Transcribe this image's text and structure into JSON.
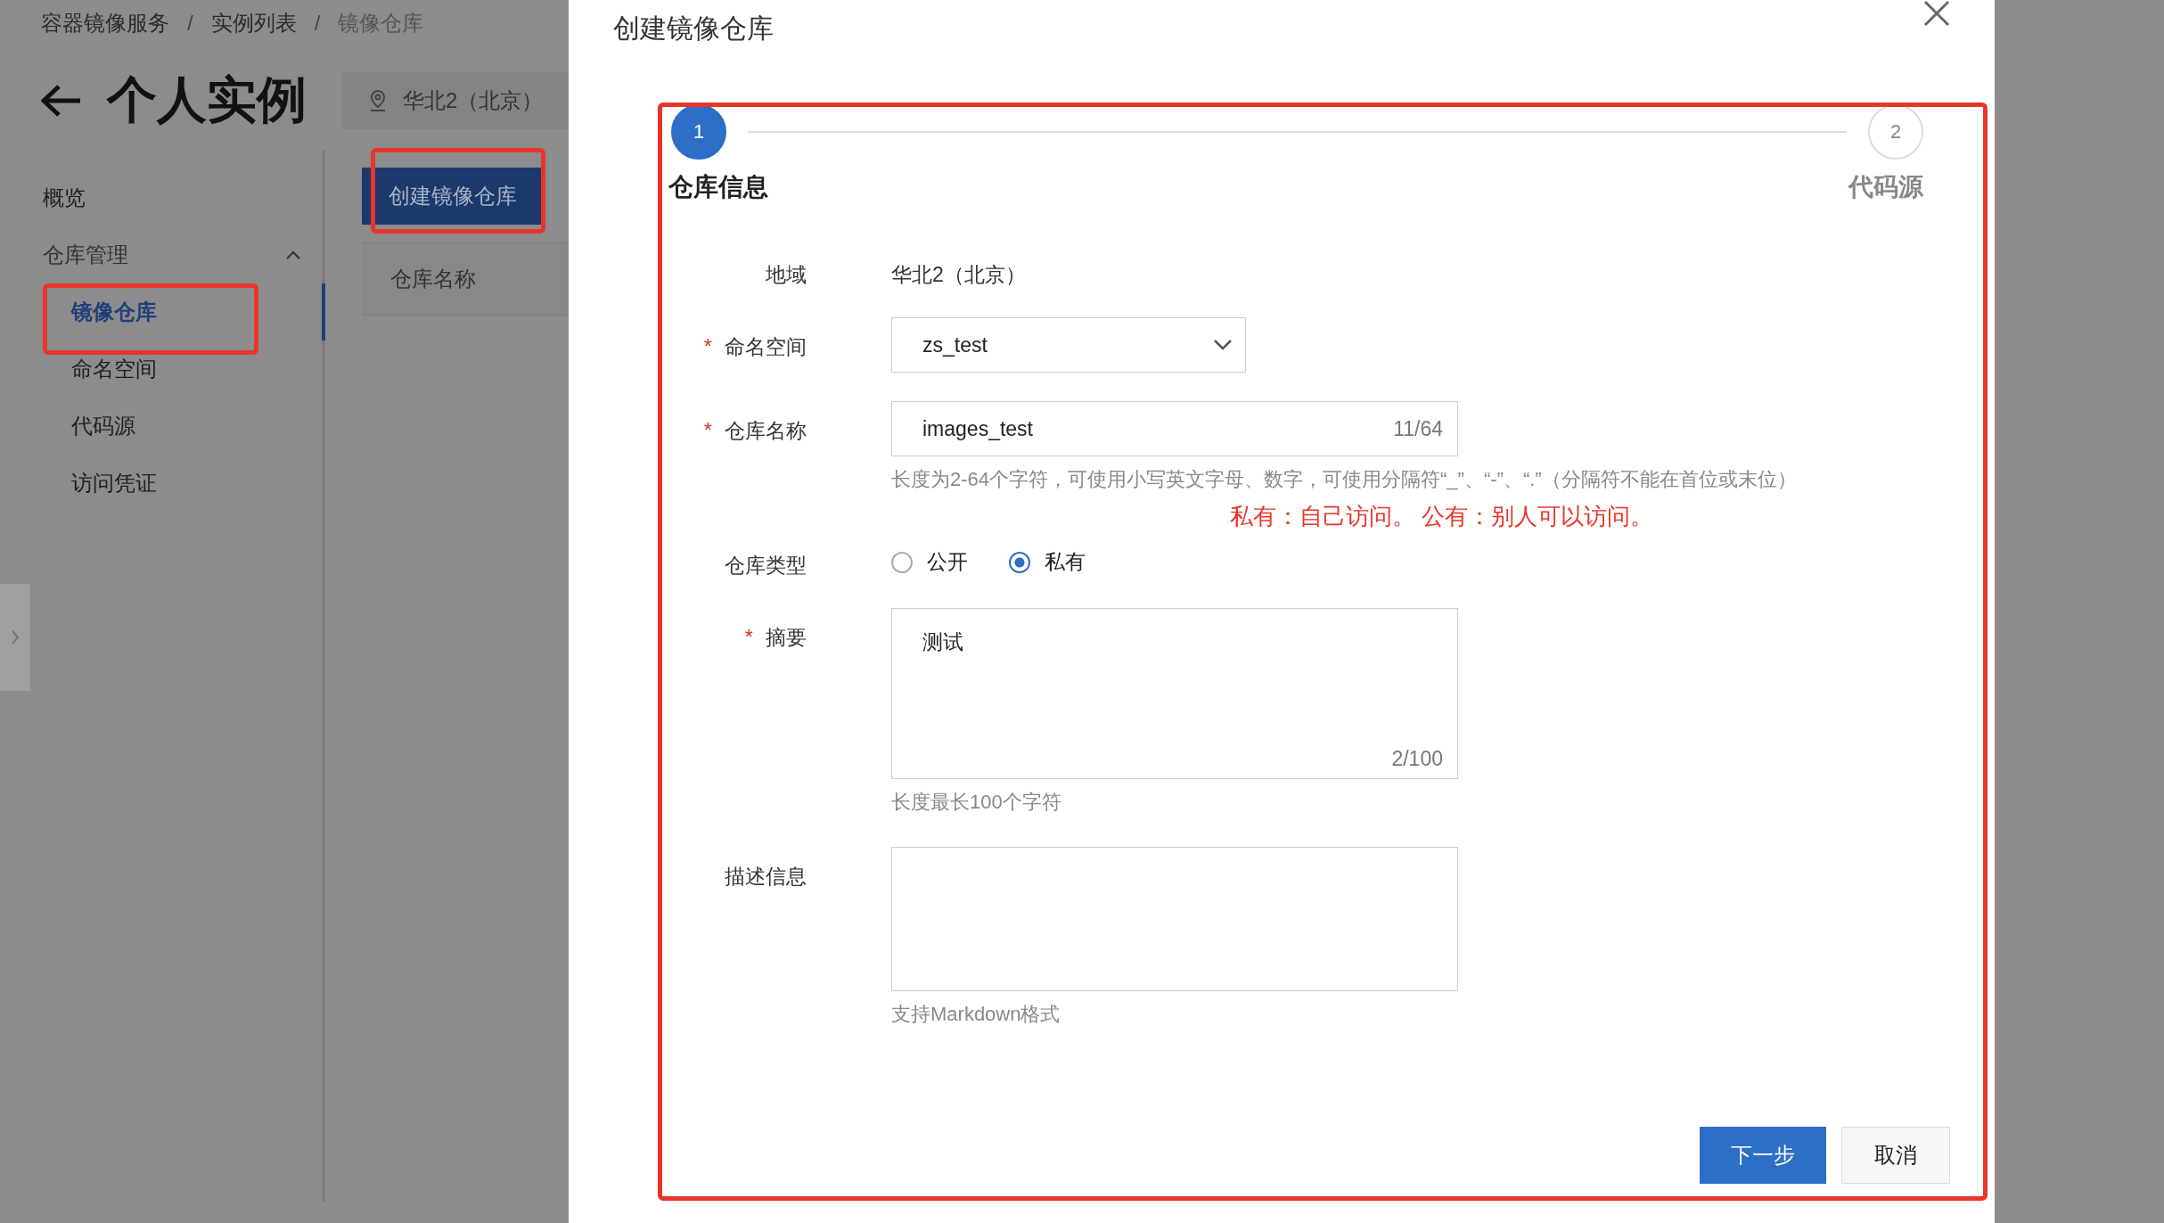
{
  "breadcrumb": [
    {
      "label": "容器镜像服务",
      "separator": "/"
    },
    {
      "label": "实例列表",
      "separator": "/"
    },
    {
      "label": "镜像仓库"
    }
  ],
  "page": {
    "title": "个人实例",
    "region": "华北2（北京）"
  },
  "sidebar": {
    "items": [
      {
        "label": "概览",
        "selected": false
      },
      {
        "label": "仓库管理",
        "expanded": true,
        "children": [
          {
            "label": "镜像仓库",
            "selected": true
          },
          {
            "label": "命名空间",
            "selected": false
          },
          {
            "label": "代码源",
            "selected": false
          },
          {
            "label": "访问凭证",
            "selected": false
          }
        ]
      }
    ]
  },
  "toolbar": {
    "create_button": "创建镜像仓库"
  },
  "table": {
    "columns": [
      "仓库名称"
    ]
  },
  "dialog": {
    "title": "创建镜像仓库",
    "steps": [
      {
        "number": "1",
        "label": "仓库信息",
        "selected": true
      },
      {
        "number": "2",
        "label": "代码源",
        "selected": false
      }
    ],
    "fields": [
      {
        "kind": "text",
        "label": "地域",
        "value": "华北2（北京）"
      },
      {
        "kind": "select",
        "label": "命名空间",
        "required_mark": "*",
        "value": "zs_test"
      },
      {
        "kind": "input",
        "label": "仓库名称",
        "required_mark": "*",
        "value": "images_test",
        "counter": "11/64",
        "hint": "长度为2-64个字符，可使用小写英文字母、数字，可使用分隔符“_”、“-”、“.”（分隔符不能在首位或末位）"
      },
      {
        "kind": "note",
        "text": "私有：自己访问。 公有：别人可以访问。"
      },
      {
        "kind": "radio",
        "label": "仓库类型",
        "options": [
          {
            "label": "公开",
            "selected": false
          },
          {
            "label": "私有",
            "selected": true
          }
        ]
      },
      {
        "kind": "textarea",
        "label": "摘要",
        "required_mark": "*",
        "value": "测试",
        "counter": "2/100",
        "hint": "长度最长100个字符"
      },
      {
        "kind": "textarea",
        "label": "描述信息",
        "hint": "支持Markdown格式"
      }
    ],
    "buttons": [
      {
        "label": "下一步",
        "primary": true
      },
      {
        "label": "取消",
        "primary": false
      }
    ]
  }
}
